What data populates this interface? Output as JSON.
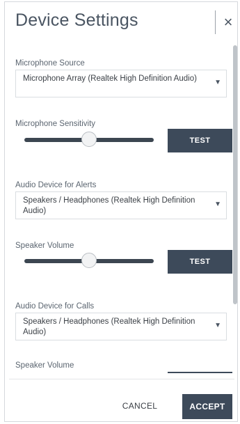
{
  "dialog": {
    "title": "Device Settings",
    "close_glyph": "×"
  },
  "microphone": {
    "source_label": "Microphone Source",
    "source_value": "Microphone Array (Realtek High Definition Audio)",
    "sensitivity_label": "Microphone Sensitivity",
    "sensitivity_level": 0.5,
    "test_label": "TEST"
  },
  "alerts": {
    "device_label": "Audio Device for Alerts",
    "device_value": "Speakers / Headphones (Realtek High Definition Audio)",
    "volume_label": "Speaker Volume",
    "volume_level": 0.5,
    "test_label": "TEST"
  },
  "calls": {
    "device_label": "Audio Device for Calls",
    "device_value": "Speakers / Headphones (Realtek High Definition Audio)",
    "volume_label": "Speaker Volume"
  },
  "footer": {
    "cancel_label": "CANCEL",
    "accept_label": "ACCEPT"
  },
  "colors": {
    "primary_button": "#3d4a5a",
    "slider_track": "#3c4651"
  },
  "icons": {
    "close": "close-icon",
    "caret": "chevron-down-icon"
  }
}
